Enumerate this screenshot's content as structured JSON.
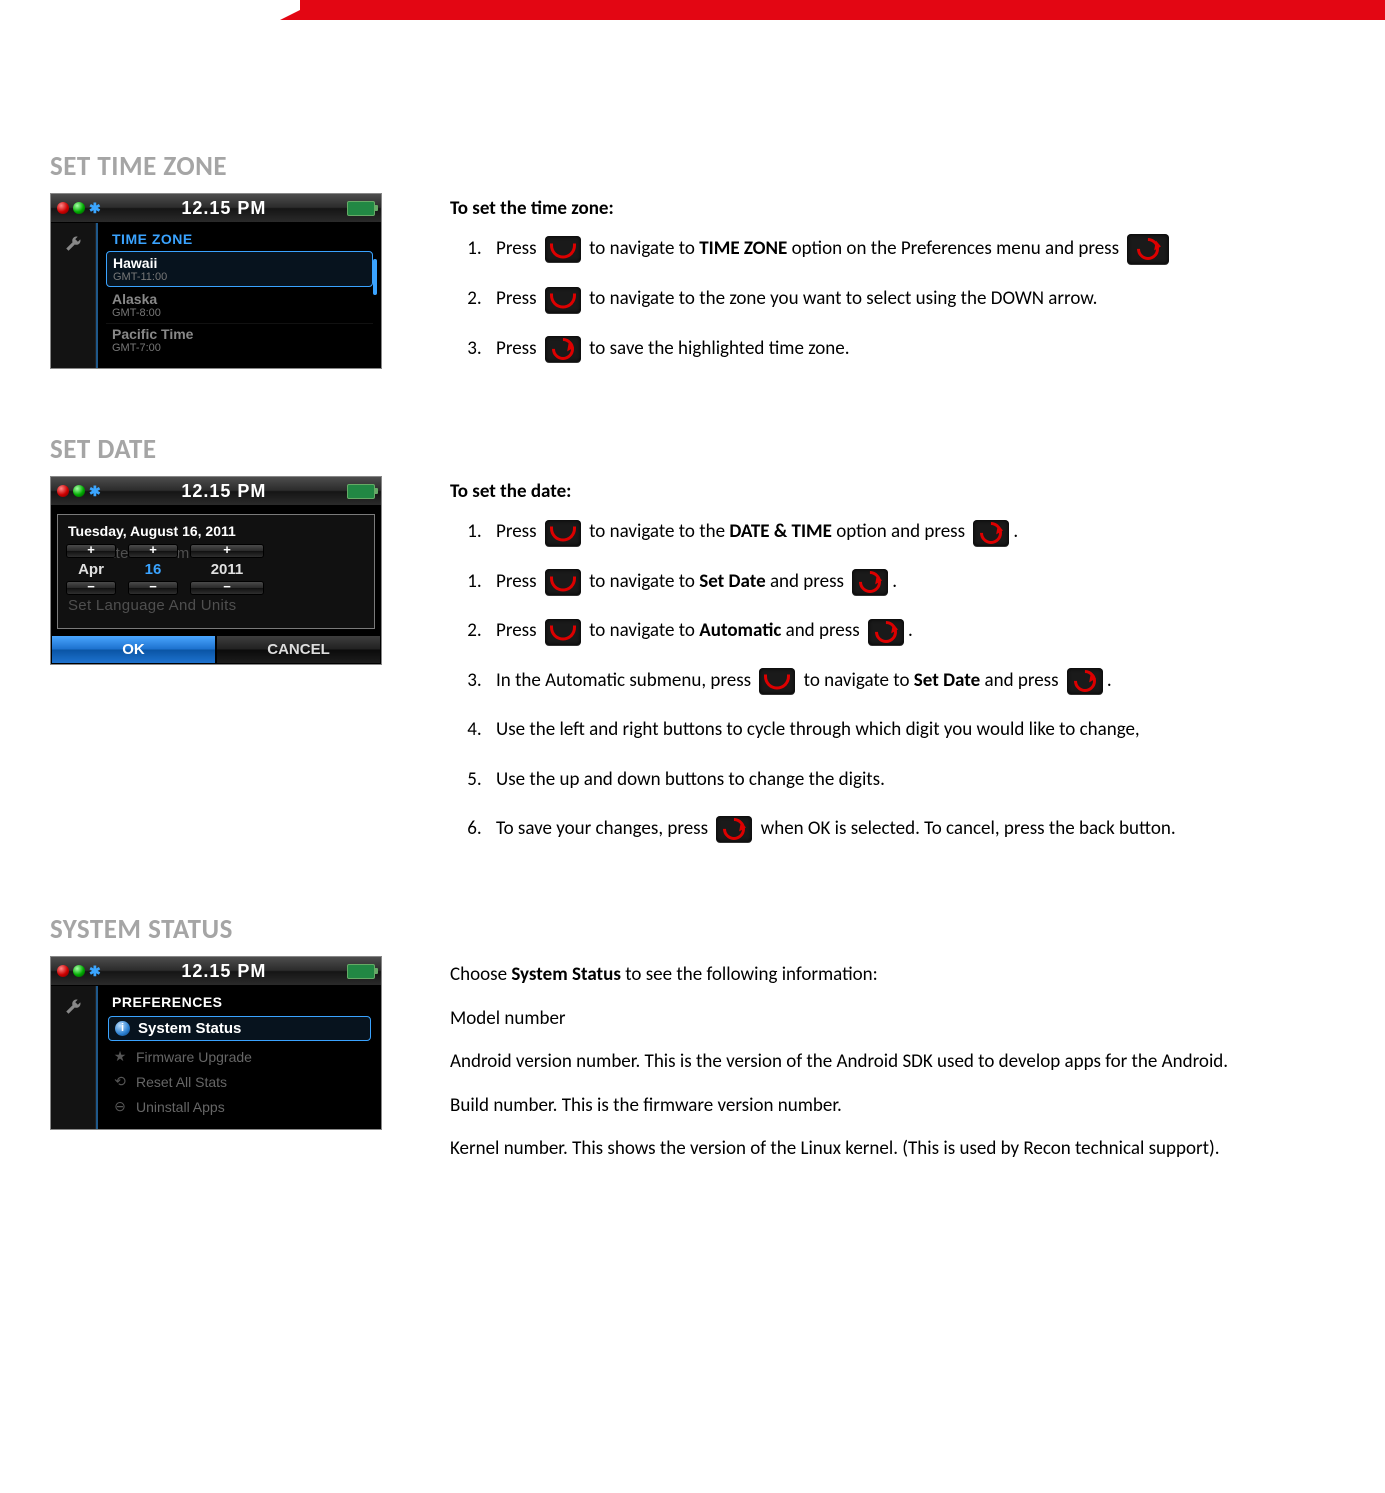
{
  "common": {
    "clock": "12.15 PM"
  },
  "section1": {
    "heading": "SET TIME ZONE",
    "lead": "To set the time zone:",
    "screen": {
      "title": "TIME ZONE",
      "opt1_name": "Hawaii",
      "opt1_gmt": "GMT-11:00",
      "opt2_name": "Alaska",
      "opt2_gmt": "GMT-8:00",
      "opt3_name": "Pacific Time",
      "opt3_gmt": "GMT-7:00"
    },
    "steps": {
      "s1a": "Press ",
      "s1b": " to navigate to ",
      "s1_bold": "TIME ZONE",
      "s1c": " option on the Preferences menu and press ",
      "s2a": "Press ",
      "s2b": " to navigate to the zone you want to select using the DOWN arrow.",
      "s3a": "Press ",
      "s3b": " to save the highlighted time zone."
    }
  },
  "section2": {
    "heading": "SET DATE",
    "lead": "To set the date:",
    "screen": {
      "date_header": "Tuesday, August 16, 2011",
      "faded1": "Set Date And Time",
      "faded2": "Set Language And Units",
      "month": "Apr",
      "day": "16",
      "year": "2011",
      "ok": "OK",
      "cancel": "CANCEL"
    },
    "steps": {
      "s1a": "Press ",
      "s1b": " to navigate to the ",
      "s1_bold": "DATE & TIME",
      "s1c": " option and press ",
      "s1d": ".",
      "s1_2a": "Press ",
      "s1_2b": " to navigate to ",
      "s1_2_bold": "Set Date",
      "s1_2c": " and press ",
      "s2a": "Press ",
      "s2b": " to navigate to ",
      "s2_bold": "Automatic",
      "s2c": " and press ",
      "s3a": "In the Automatic submenu, press ",
      "s3b": " to navigate to ",
      "s3_bold": "Set Date",
      "s3c": " and press ",
      "s4": "Use the left and right buttons to cycle through which digit you would like to change,",
      "s5": "Use the up and down buttons to change the digits.",
      "s6a": "To save your changes, press ",
      "s6b": " when OK is selected. To cancel, press the back button."
    }
  },
  "section3": {
    "heading": "SYSTEM STATUS",
    "screen": {
      "title": "PREFERENCES",
      "row1": "System Status",
      "row2": "Firmware Upgrade",
      "row3": "Reset All Stats",
      "row4": "Uninstall Apps"
    },
    "paras": {
      "p1a": "Choose ",
      "p1b": "System Status",
      "p1c": " to see the following information:",
      "p2": "Model number",
      "p3": "Android version number. This is the version of the Android SDK used to develop apps for the Android.",
      "p4": "Build number. This is the firmware version number.",
      "p5": "Kernel number. This shows the version of the Linux kernel. (This is used by Recon technical support)."
    }
  }
}
